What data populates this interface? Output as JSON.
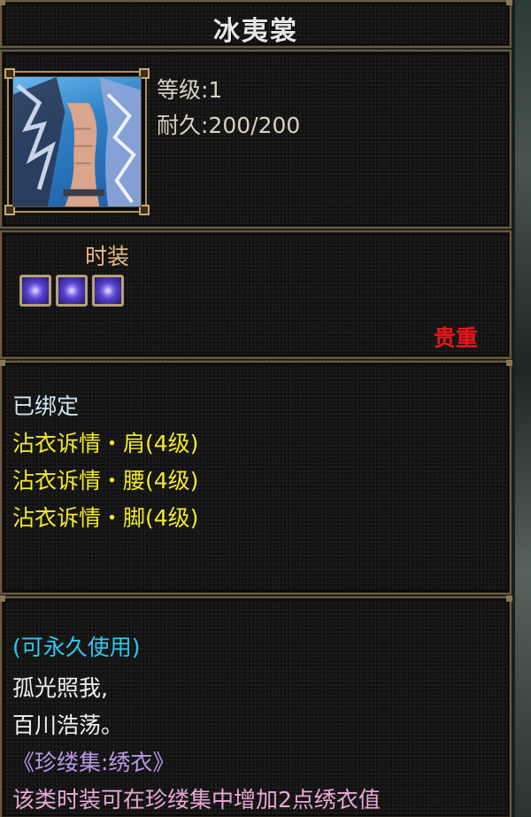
{
  "item": {
    "name": "冰夷裳",
    "level": "等级:1",
    "durability": "耐久:200/200",
    "type": "时装",
    "rarity": "贵重",
    "gem_slots": 3,
    "portrait_icon": "fashion-costume-icon"
  },
  "bind": {
    "status": "已绑定",
    "set_effects": [
      "沾衣诉情・肩(4级)",
      "沾衣诉情・腰(4级)",
      "沾衣诉情・脚(4级)"
    ]
  },
  "description": {
    "usage": "(可永久使用)",
    "poem_line1": "孤光照我,",
    "poem_line2": "百川浩荡。",
    "source": "《珍缕集:绣衣》",
    "note": "该类时装可在珍缕集中增加2点绣衣值"
  },
  "colors": {
    "border": "#6b5a3e",
    "set_effect": "#f2ea25",
    "rarity": "#e8141a",
    "usage": "#2ec9f0",
    "type": "#e8b985"
  }
}
